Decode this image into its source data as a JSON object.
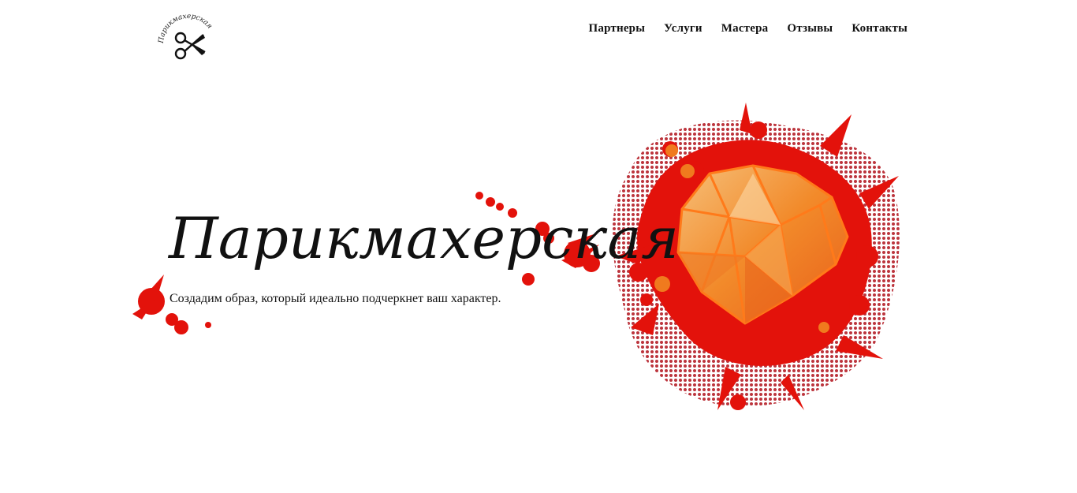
{
  "header": {
    "logo_icon": "scissors-icon",
    "logo_ring_text": "Парикмахерская",
    "nav": [
      {
        "label": "Партнеры"
      },
      {
        "label": "Услуги"
      },
      {
        "label": "Мастера"
      },
      {
        "label": "Отзывы"
      },
      {
        "label": "Контакты"
      }
    ]
  },
  "hero": {
    "title": "Парикмахерская",
    "subtitle": "Создадим образ, который идеально подчеркнет ваш характер.",
    "art_icon": "diamond-icon"
  },
  "colors": {
    "accent_red": "#e3120b",
    "accent_orange": "#f07a1e",
    "text": "#111111",
    "background": "#ffffff"
  }
}
